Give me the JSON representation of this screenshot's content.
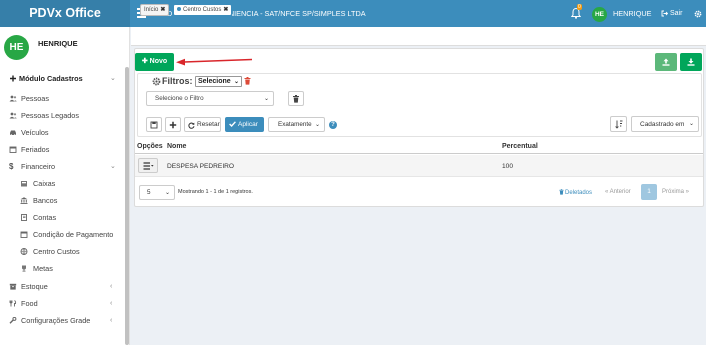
{
  "app": {
    "title": "PDVx Office",
    "company": "MBD GROUP CONVENIENCIA - SAT/NFCE SP/SIMPLES LTDA"
  },
  "header": {
    "notification_count": "0",
    "user_initials": "HE",
    "user_name": "HENRIQUE",
    "logout_label": "Sair"
  },
  "sidebar": {
    "user_initials": "HE",
    "user_name": "HENRIQUE",
    "section": "Módulo Cadastros",
    "items": [
      {
        "label": "Pessoas",
        "icon": "users-icon"
      },
      {
        "label": "Pessoas Legados",
        "icon": "users-icon"
      },
      {
        "label": "Veículos",
        "icon": "car-icon"
      },
      {
        "label": "Feriados",
        "icon": "calendar-icon"
      },
      {
        "label": "Financeiro",
        "icon": "dollar-icon"
      },
      {
        "label": "Caixas",
        "icon": "cash-icon"
      },
      {
        "label": "Bancos",
        "icon": "bank-icon"
      },
      {
        "label": "Contas",
        "icon": "book-icon"
      },
      {
        "label": "Condição de Pagamento",
        "icon": "calendar-icon"
      },
      {
        "label": "Centro Custos",
        "icon": "globe-icon"
      },
      {
        "label": "Metas",
        "icon": "trophy-icon"
      },
      {
        "label": "Estoque",
        "icon": "archive-icon"
      },
      {
        "label": "Food",
        "icon": "utensils-icon"
      },
      {
        "label": "Configurações Grade",
        "icon": "wrench-icon"
      }
    ]
  },
  "tabs": [
    {
      "label": "Início"
    },
    {
      "label": "Centro Custos"
    }
  ],
  "toolbar": {
    "new_label": "Novo"
  },
  "filters": {
    "title": "Filtros:",
    "saved_filter": "Selecione",
    "filter_select_placeholder": "Selecione o Filtro",
    "reset_label": "Resetar",
    "apply_label": "Aplicar",
    "match_mode": "Exatamente",
    "sort_field": "Cadastrado em"
  },
  "table": {
    "columns": [
      "Opções",
      "Nome",
      "Percentual"
    ],
    "rows": [
      {
        "nome": "DESPESA PEDREIRO",
        "percentual": "100"
      }
    ]
  },
  "footer": {
    "per_page": "5",
    "showing": "Mostrando 1 - 1 de 1 registros.",
    "deleted_label": "Deletados",
    "prev_label": "« Anterior",
    "current_page": "1",
    "next_label": "Próxima »"
  },
  "colors": {
    "primary": "#3c8dbc",
    "success": "#00a65a",
    "danger": "#dd4b39"
  }
}
